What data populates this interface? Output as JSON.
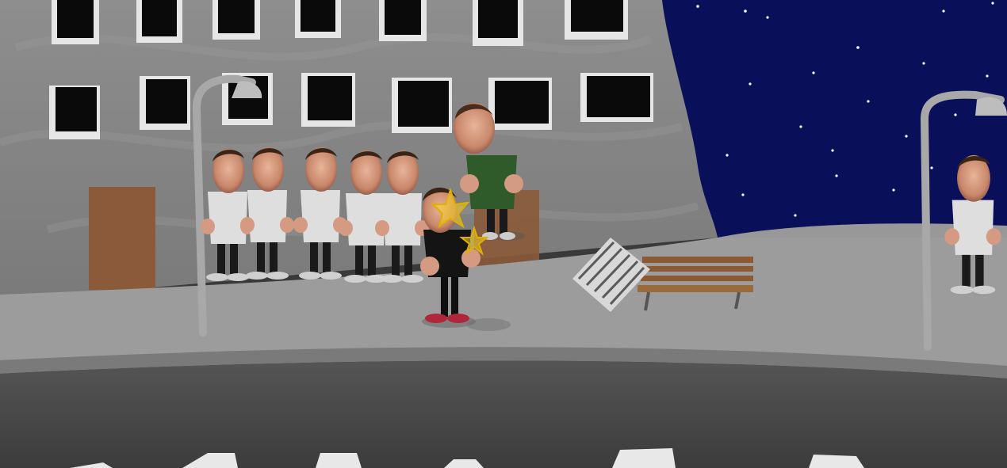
{
  "scene": {
    "setting": "night-street",
    "colors": {
      "sky": "#0a0f5a",
      "building": "#8a8a8a",
      "sidewalk": "#9a9a9a",
      "road": "#4a4a4a",
      "window": "#0a0a0a",
      "door": "#8a5a3a",
      "bench": "#8b5a32",
      "lamp": "#a8a8a8",
      "star_effect": "#f5d020"
    },
    "characters": {
      "clone_count": 6,
      "player_outfit": "black",
      "floating_outfit": "green",
      "clone_outfit": "white"
    },
    "effects": [
      "star-burst",
      "star-burst"
    ]
  }
}
